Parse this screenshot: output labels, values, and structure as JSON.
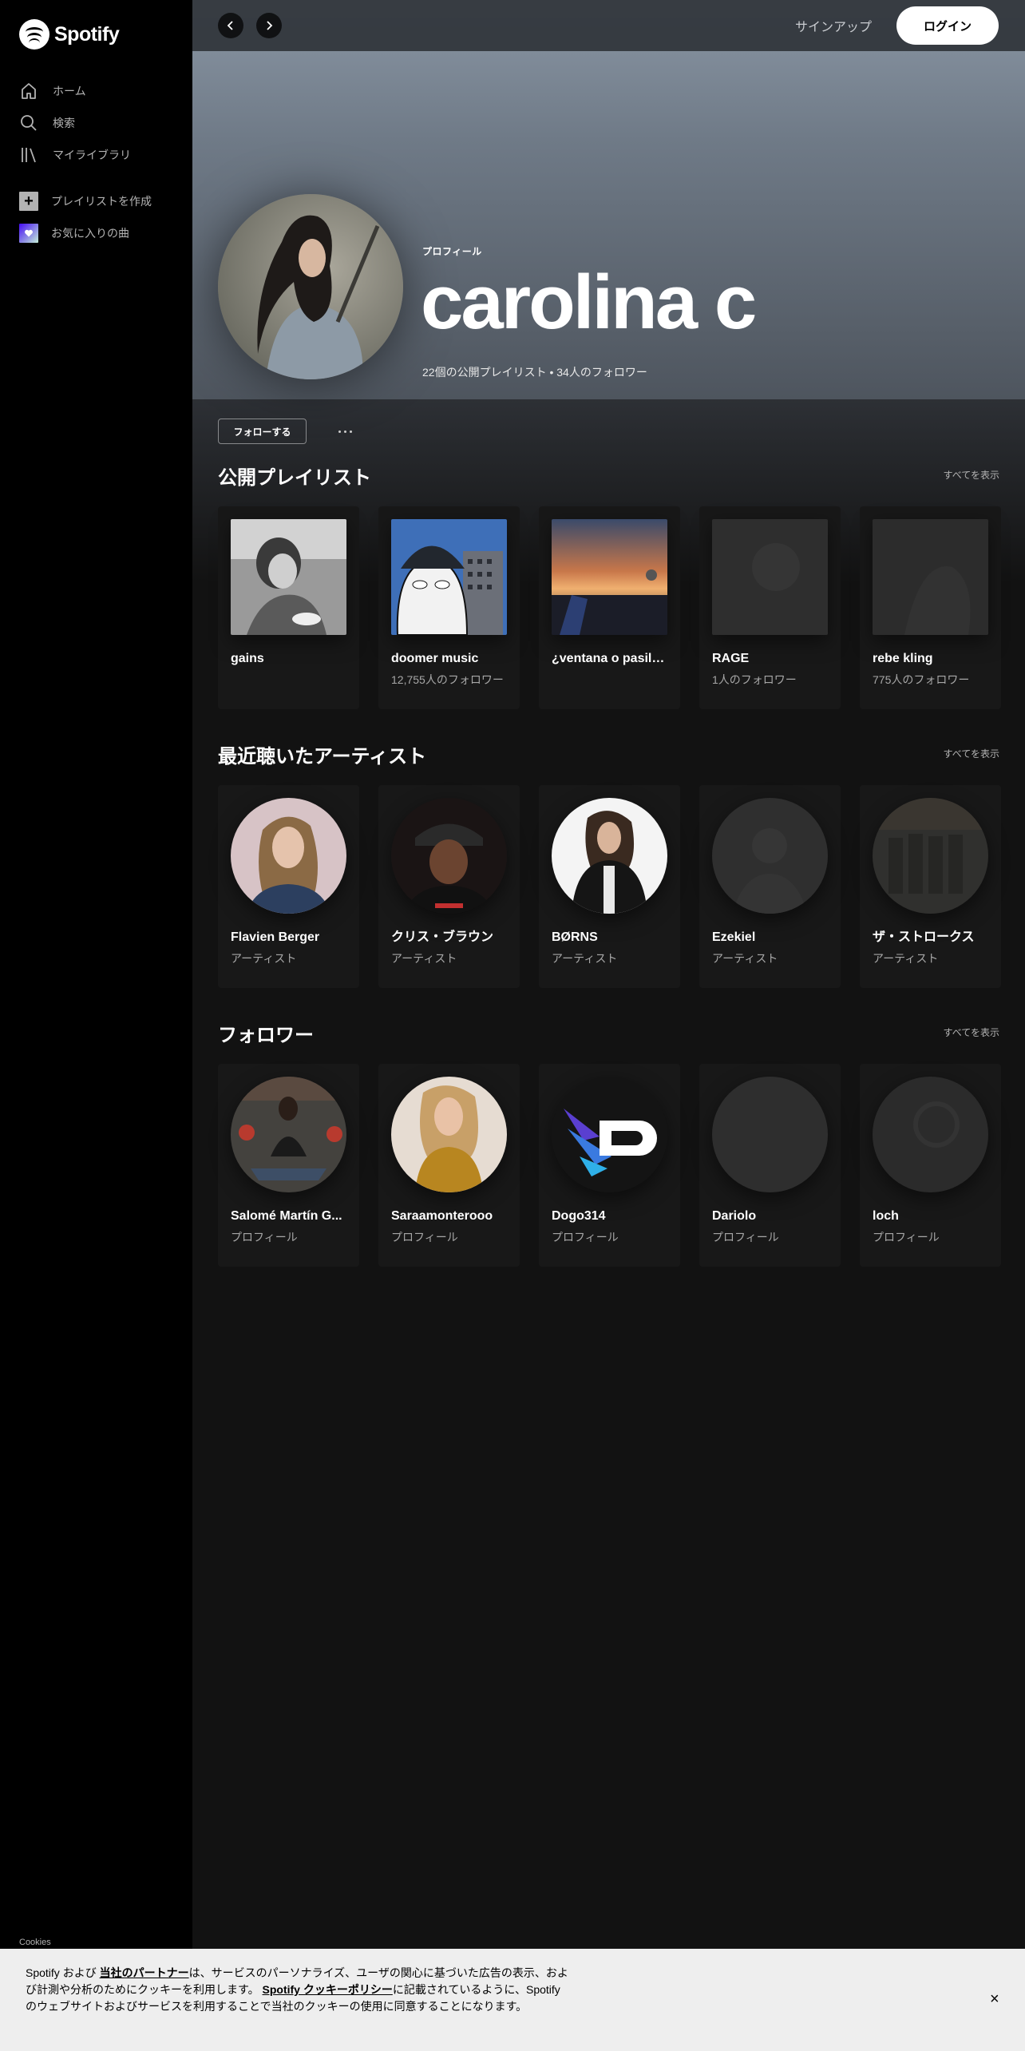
{
  "brand": {
    "name": "Spotify"
  },
  "sidebar": {
    "nav": [
      {
        "label": "ホーム",
        "icon": "home-icon"
      },
      {
        "label": "検索",
        "icon": "search-icon"
      },
      {
        "label": "マイライブラリ",
        "icon": "library-icon"
      }
    ],
    "actions": [
      {
        "label": "プレイリストを作成",
        "icon": "plus-icon"
      },
      {
        "label": "お気に入りの曲",
        "icon": "heart-icon"
      }
    ],
    "cookies_link": "Cookies"
  },
  "topbar": {
    "signup": "サインアップ",
    "login": "ログイン"
  },
  "profile": {
    "type_label": "プロフィール",
    "name": "carolina c",
    "stats": "22個の公開プレイリスト • 34人のフォロワー",
    "follow_button": "フォローする"
  },
  "sections": {
    "playlists": {
      "title": "公開プレイリスト",
      "see_all": "すべてを表示",
      "items": [
        {
          "title": "gains",
          "subtitle": ""
        },
        {
          "title": "doomer music",
          "subtitle": "12,755人のフォロワー"
        },
        {
          "title": "¿ventana o pasillo?",
          "subtitle": ""
        },
        {
          "title": "RAGE",
          "subtitle": "1人のフォロワー"
        },
        {
          "title": "rebe kling",
          "subtitle": "775人のフォロワー"
        }
      ]
    },
    "artists": {
      "title": "最近聴いたアーティスト",
      "see_all": "すべてを表示",
      "items": [
        {
          "title": "Flavien Berger",
          "subtitle": "アーティスト"
        },
        {
          "title": "クリス・ブラウン",
          "subtitle": "アーティスト"
        },
        {
          "title": "BØRNS",
          "subtitle": "アーティスト"
        },
        {
          "title": "Ezekiel",
          "subtitle": "アーティスト"
        },
        {
          "title": "ザ・ストロークス",
          "subtitle": "アーティスト"
        }
      ]
    },
    "followers": {
      "title": "フォロワー",
      "see_all": "すべてを表示",
      "items": [
        {
          "title": "Salomé Martín G...",
          "subtitle": "プロフィール"
        },
        {
          "title": "Saraamonterooo",
          "subtitle": "プロフィール"
        },
        {
          "title": "Dogo314",
          "subtitle": "プロフィール"
        },
        {
          "title": "Dariolo",
          "subtitle": "プロフィール"
        },
        {
          "title": "loch",
          "subtitle": "プロフィール"
        }
      ]
    }
  },
  "cookie_banner": {
    "text_1": "Spotify および ",
    "link_partners": "当社のパートナー",
    "text_2": "は、サービスのパーソナライズ、ユーザの関心に基づいた広告の表示、および計測や分析のためにクッキーを利用します。 ",
    "link_policy": "Spotify クッキーポリシー",
    "text_3": "に記載されているように、Spotify のウェブサイトおよびサービスを利用することで当社のクッキーの使用に同意することになります。",
    "close": "×"
  },
  "colors": {
    "accent": "#1db954",
    "background": "#121212",
    "sidebar": "#000000",
    "card": "#181818"
  }
}
